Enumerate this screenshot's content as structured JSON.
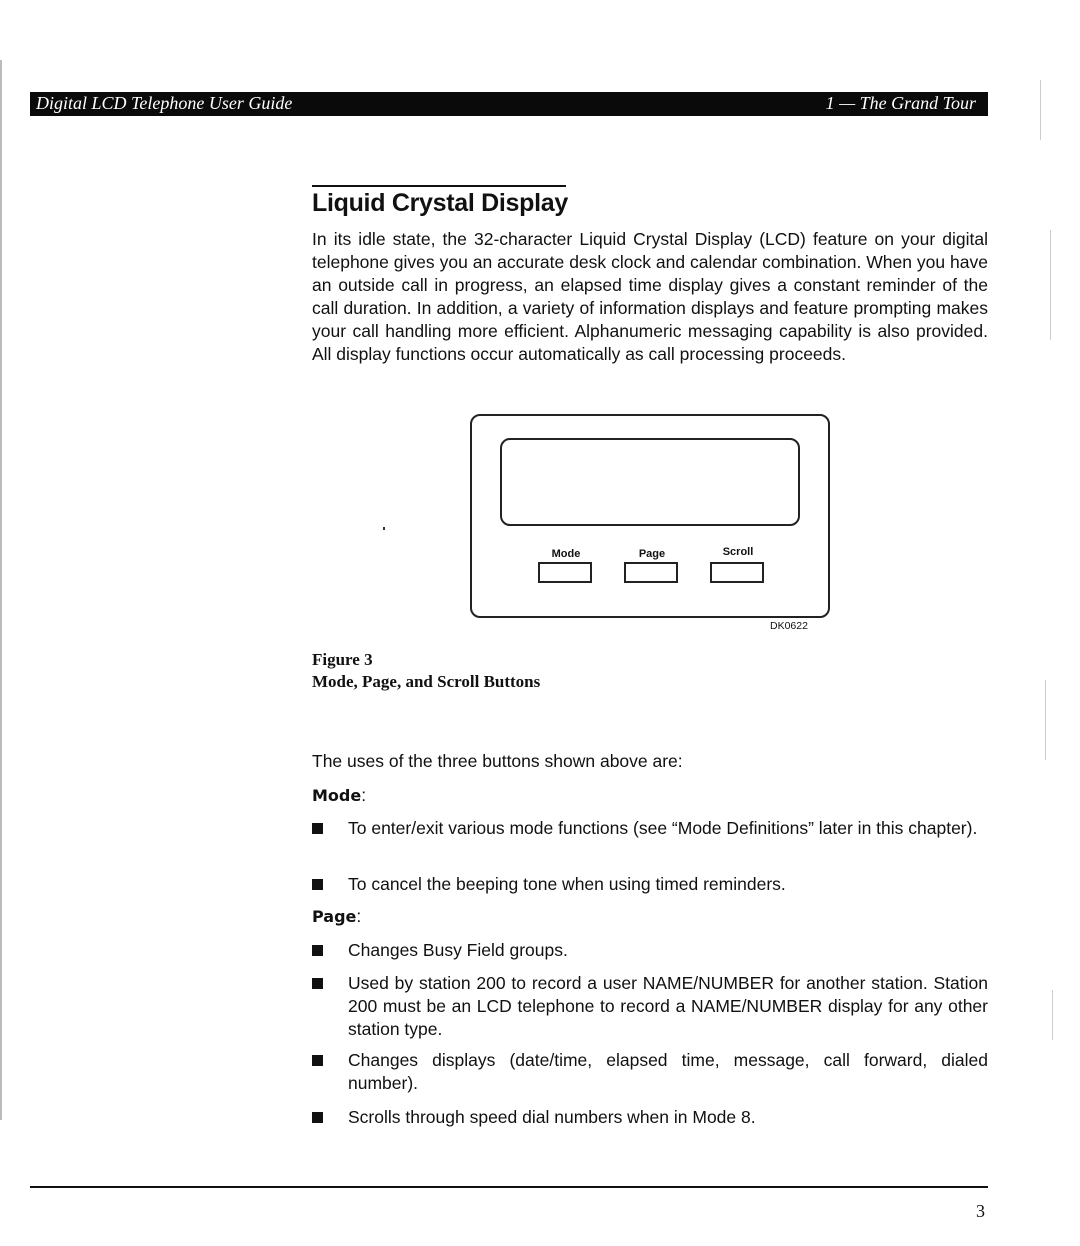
{
  "header": {
    "title": "Digital LCD Telephone User Guide",
    "chapter": "1 — The Grand Tour"
  },
  "section": {
    "title": "Liquid Crystal Display",
    "paragraph": "In its idle state, the 32-character Liquid Crystal Display (LCD) feature on your digital telephone gives you an accurate desk clock and calendar combination. When you have an outside call in progress, an elapsed time display gives a constant reminder of the call duration. In addition, a variety of information displays and feature prompting makes your call handling more efficient. Alphanumeric messaging capability is also provided. All display functions occur automatically as call processing proceeds."
  },
  "figure": {
    "buttons": [
      "Mode",
      "Page",
      "Scroll"
    ],
    "code": "DK0622",
    "number": "Figure 3",
    "caption": "Mode, Page, and Scroll Buttons"
  },
  "uses": {
    "intro": "The uses of the three buttons shown above are:",
    "mode": {
      "label": "Mode",
      "colon": ":",
      "items": [
        "To enter/exit various mode functions (see “Mode Definitions” later in this chapter).",
        "To cancel the beeping tone when using timed reminders."
      ]
    },
    "page": {
      "label": "Page",
      "colon": ":",
      "items": [
        "Changes Busy Field groups.",
        "Used by station 200 to record a user NAME/NUMBER for another station. Station 200 must be an LCD telephone to record a NAME/NUMBER display for any other station type.",
        "Changes displays (date/time, elapsed time, message, call forward, dialed number).",
        "Scrolls through speed dial numbers when in Mode 8."
      ]
    }
  },
  "footer": {
    "page_number": "3"
  }
}
